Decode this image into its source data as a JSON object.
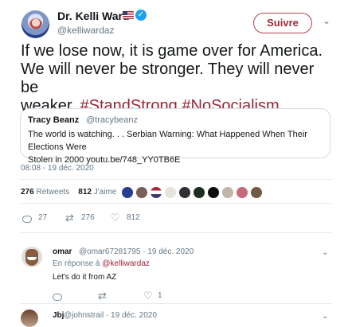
{
  "tweet": {
    "author_name": "Dr. Kelli Ward",
    "author_handle": "@kelliwardaz",
    "follow_label": "Suivre",
    "text_line1": "If we lose now, it is game over for America.",
    "text_line2": "We will never be stronger. They will never be",
    "text_line3_start": "weaker. ",
    "hashtag1": "#StandStrong",
    "hashtag2": "#NoSocialism",
    "timestamp": "08:08 - 19 déc. 2020"
  },
  "quote": {
    "author_name": "Tracy Beanz",
    "author_handle": "@tracybeanz",
    "line1": "The world is watching. . . Serbian Warning: What Happened When Their Elections Were",
    "line2": "Stolen in 2000 youtu.be/748_YY0TB6E"
  },
  "stats": {
    "retweets_count": "276",
    "retweets_label": "Retweets",
    "likes_count": "812",
    "likes_label": "J'aime"
  },
  "actions": {
    "reply_count": "27",
    "retweet_count": "276",
    "like_count": "812"
  },
  "reply": {
    "name": "omar",
    "meta": "@omar67281795 · 19 déc. 2020",
    "reply_prefix": "En réponse à ",
    "reply_handle": "@kelliwardaz",
    "text": "Let's do it from AZ",
    "like_count": "1"
  },
  "next_reply": {
    "name": "Jbj",
    "meta": "@johnstrail · 19 déc. 2020"
  },
  "colors": {
    "accent": "#9b2335",
    "muted": "#657786",
    "verified": "#1da1f2"
  }
}
